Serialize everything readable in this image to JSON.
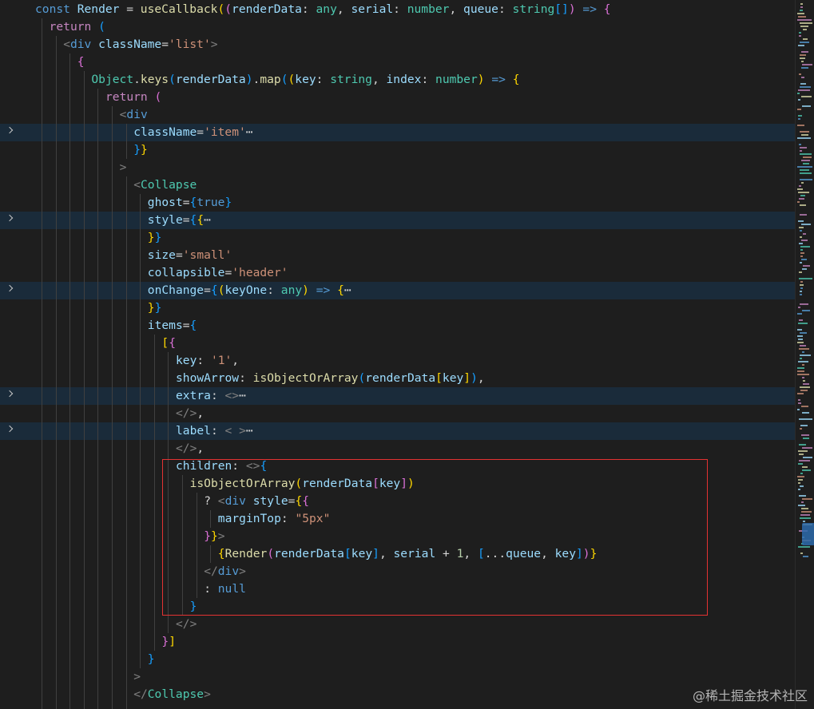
{
  "colors": {
    "keyword": "#569cd6",
    "control": "#c586c0",
    "function": "#dcdcaa",
    "variable": "#9cdcfe",
    "string": "#ce9178",
    "type": "#4ec9b0",
    "number": "#b5cea8",
    "tag": "#569cd6",
    "brace_gold": "#ffd700",
    "brace_pink": "#da70d6",
    "brace_blue": "#179fff",
    "punct": "#d4d4d4",
    "tagpunct": "#808080",
    "highlight_box": "#e33232",
    "editor_bg": "#1e1e1e",
    "folded_line_bg": "#1a2b3a"
  },
  "editor": {
    "lines": [
      {
        "indent": 0,
        "guides": 0,
        "tokens": [
          {
            "t": "const ",
            "c": "keyword"
          },
          {
            "t": "Render",
            "c": "variable"
          },
          {
            "t": " = ",
            "c": "punct"
          },
          {
            "t": "useCallback",
            "c": "function"
          },
          {
            "t": "(",
            "c": "brace_gold"
          },
          {
            "t": "(",
            "c": "brace_pink"
          },
          {
            "t": "renderData",
            "c": "variable"
          },
          {
            "t": ": ",
            "c": "punct"
          },
          {
            "t": "any",
            "c": "type"
          },
          {
            "t": ", ",
            "c": "punct"
          },
          {
            "t": "serial",
            "c": "variable"
          },
          {
            "t": ": ",
            "c": "punct"
          },
          {
            "t": "number",
            "c": "type"
          },
          {
            "t": ", ",
            "c": "punct"
          },
          {
            "t": "queue",
            "c": "variable"
          },
          {
            "t": ": ",
            "c": "punct"
          },
          {
            "t": "string",
            "c": "type"
          },
          {
            "t": "[]",
            "c": "brace_blue"
          },
          {
            "t": ")",
            "c": "brace_pink"
          },
          {
            "t": " => ",
            "c": "keyword"
          },
          {
            "t": "{",
            "c": "brace_pink"
          }
        ]
      },
      {
        "indent": 1,
        "guides": 1,
        "tokens": [
          {
            "t": "return ",
            "c": "control"
          },
          {
            "t": "(",
            "c": "brace_blue"
          }
        ]
      },
      {
        "indent": 2,
        "guides": 2,
        "tokens": [
          {
            "t": "<",
            "c": "tagpunct"
          },
          {
            "t": "div ",
            "c": "tag"
          },
          {
            "t": "className",
            "c": "variable"
          },
          {
            "t": "=",
            "c": "punct"
          },
          {
            "t": "'list'",
            "c": "string"
          },
          {
            "t": ">",
            "c": "tagpunct"
          }
        ]
      },
      {
        "indent": 3,
        "guides": 3,
        "tokens": [
          {
            "t": "{",
            "c": "brace_pink"
          }
        ]
      },
      {
        "indent": 4,
        "guides": 4,
        "tokens": [
          {
            "t": "Object",
            "c": "type"
          },
          {
            "t": ".",
            "c": "punct"
          },
          {
            "t": "keys",
            "c": "function"
          },
          {
            "t": "(",
            "c": "brace_blue"
          },
          {
            "t": "renderData",
            "c": "variable"
          },
          {
            "t": ")",
            "c": "brace_blue"
          },
          {
            "t": ".",
            "c": "punct"
          },
          {
            "t": "map",
            "c": "function"
          },
          {
            "t": "(",
            "c": "brace_blue"
          },
          {
            "t": "(",
            "c": "brace_gold"
          },
          {
            "t": "key",
            "c": "variable"
          },
          {
            "t": ": ",
            "c": "punct"
          },
          {
            "t": "string",
            "c": "type"
          },
          {
            "t": ", ",
            "c": "punct"
          },
          {
            "t": "index",
            "c": "variable"
          },
          {
            "t": ": ",
            "c": "punct"
          },
          {
            "t": "number",
            "c": "type"
          },
          {
            "t": ")",
            "c": "brace_gold"
          },
          {
            "t": " => ",
            "c": "keyword"
          },
          {
            "t": "{",
            "c": "brace_gold"
          }
        ]
      },
      {
        "indent": 5,
        "guides": 5,
        "tokens": [
          {
            "t": "return ",
            "c": "control"
          },
          {
            "t": "(",
            "c": "brace_pink"
          }
        ]
      },
      {
        "indent": 6,
        "guides": 6,
        "tokens": [
          {
            "t": "<",
            "c": "tagpunct"
          },
          {
            "t": "div",
            "c": "tag"
          }
        ]
      },
      {
        "indent": 7,
        "guides": 7,
        "folded": true,
        "tokens": [
          {
            "t": "className",
            "c": "variable"
          },
          {
            "t": "=",
            "c": "punct"
          },
          {
            "t": "'item'",
            "c": "string"
          },
          {
            "t": "⋯",
            "c": "punct"
          }
        ]
      },
      {
        "indent": 7,
        "guides": 7,
        "tokens": [
          {
            "t": "}",
            "c": "brace_blue"
          },
          {
            "t": "}",
            "c": "brace_gold"
          }
        ]
      },
      {
        "indent": 6,
        "guides": 6,
        "tokens": [
          {
            "t": ">",
            "c": "tagpunct"
          }
        ]
      },
      {
        "indent": 7,
        "guides": 7,
        "tokens": [
          {
            "t": "<",
            "c": "tagpunct"
          },
          {
            "t": "Collapse",
            "c": "type"
          }
        ]
      },
      {
        "indent": 8,
        "guides": 8,
        "tokens": [
          {
            "t": "ghost",
            "c": "variable"
          },
          {
            "t": "=",
            "c": "punct"
          },
          {
            "t": "{",
            "c": "brace_blue"
          },
          {
            "t": "true",
            "c": "keyword"
          },
          {
            "t": "}",
            "c": "brace_blue"
          }
        ]
      },
      {
        "indent": 8,
        "guides": 8,
        "folded": true,
        "tokens": [
          {
            "t": "style",
            "c": "variable"
          },
          {
            "t": "=",
            "c": "punct"
          },
          {
            "t": "{",
            "c": "brace_blue"
          },
          {
            "t": "{",
            "c": "brace_gold"
          },
          {
            "t": "⋯",
            "c": "punct"
          }
        ]
      },
      {
        "indent": 8,
        "guides": 8,
        "tokens": [
          {
            "t": "}",
            "c": "brace_gold"
          },
          {
            "t": "}",
            "c": "brace_blue"
          }
        ]
      },
      {
        "indent": 8,
        "guides": 8,
        "tokens": [
          {
            "t": "size",
            "c": "variable"
          },
          {
            "t": "=",
            "c": "punct"
          },
          {
            "t": "'small'",
            "c": "string"
          }
        ]
      },
      {
        "indent": 8,
        "guides": 8,
        "tokens": [
          {
            "t": "collapsible",
            "c": "variable"
          },
          {
            "t": "=",
            "c": "punct"
          },
          {
            "t": "'header'",
            "c": "string"
          }
        ]
      },
      {
        "indent": 8,
        "guides": 8,
        "folded": true,
        "tokens": [
          {
            "t": "onChange",
            "c": "variable"
          },
          {
            "t": "=",
            "c": "punct"
          },
          {
            "t": "{",
            "c": "brace_blue"
          },
          {
            "t": "(",
            "c": "brace_gold"
          },
          {
            "t": "keyOne",
            "c": "variable"
          },
          {
            "t": ": ",
            "c": "punct"
          },
          {
            "t": "any",
            "c": "type"
          },
          {
            "t": ")",
            "c": "brace_gold"
          },
          {
            "t": " => ",
            "c": "keyword"
          },
          {
            "t": "{",
            "c": "brace_gold"
          },
          {
            "t": "⋯",
            "c": "punct"
          }
        ]
      },
      {
        "indent": 8,
        "guides": 8,
        "tokens": [
          {
            "t": "}",
            "c": "brace_gold"
          },
          {
            "t": "}",
            "c": "brace_blue"
          }
        ]
      },
      {
        "indent": 8,
        "guides": 8,
        "tokens": [
          {
            "t": "items",
            "c": "variable"
          },
          {
            "t": "=",
            "c": "punct"
          },
          {
            "t": "{",
            "c": "brace_blue"
          }
        ]
      },
      {
        "indent": 9,
        "guides": 9,
        "tokens": [
          {
            "t": "[",
            "c": "brace_gold"
          },
          {
            "t": "{",
            "c": "brace_pink"
          }
        ]
      },
      {
        "indent": 10,
        "guides": 10,
        "tokens": [
          {
            "t": "key",
            "c": "variable"
          },
          {
            "t": ": ",
            "c": "punct"
          },
          {
            "t": "'1'",
            "c": "string"
          },
          {
            "t": ",",
            "c": "punct"
          }
        ]
      },
      {
        "indent": 10,
        "guides": 10,
        "tokens": [
          {
            "t": "showArrow",
            "c": "variable"
          },
          {
            "t": ": ",
            "c": "punct"
          },
          {
            "t": "isObjectOrArray",
            "c": "function"
          },
          {
            "t": "(",
            "c": "brace_blue"
          },
          {
            "t": "renderData",
            "c": "variable"
          },
          {
            "t": "[",
            "c": "brace_gold"
          },
          {
            "t": "key",
            "c": "variable"
          },
          {
            "t": "]",
            "c": "brace_gold"
          },
          {
            "t": ")",
            "c": "brace_blue"
          },
          {
            "t": ",",
            "c": "punct"
          }
        ]
      },
      {
        "indent": 10,
        "guides": 10,
        "folded": true,
        "tokens": [
          {
            "t": "extra",
            "c": "variable"
          },
          {
            "t": ": ",
            "c": "punct"
          },
          {
            "t": "<>",
            "c": "tagpunct"
          },
          {
            "t": "⋯",
            "c": "punct"
          }
        ]
      },
      {
        "indent": 10,
        "guides": 10,
        "tokens": [
          {
            "t": "</>",
            "c": "tagpunct"
          },
          {
            "t": ",",
            "c": "punct"
          }
        ]
      },
      {
        "indent": 10,
        "guides": 10,
        "folded": true,
        "tokens": [
          {
            "t": "label",
            "c": "variable"
          },
          {
            "t": ": ",
            "c": "punct"
          },
          {
            "t": "< >",
            "c": "tagpunct"
          },
          {
            "t": "⋯",
            "c": "punct"
          }
        ]
      },
      {
        "indent": 10,
        "guides": 10,
        "tokens": [
          {
            "t": "</>",
            "c": "tagpunct"
          },
          {
            "t": ",",
            "c": "punct"
          }
        ]
      },
      {
        "indent": 10,
        "guides": 10,
        "tokens": [
          {
            "t": "children",
            "c": "variable"
          },
          {
            "t": ": ",
            "c": "punct"
          },
          {
            "t": "<>",
            "c": "tagpunct"
          },
          {
            "t": "{",
            "c": "brace_blue"
          }
        ]
      },
      {
        "indent": 11,
        "guides": 11,
        "tokens": [
          {
            "t": "isObjectOrArray",
            "c": "function"
          },
          {
            "t": "(",
            "c": "brace_gold"
          },
          {
            "t": "renderData",
            "c": "variable"
          },
          {
            "t": "[",
            "c": "brace_pink"
          },
          {
            "t": "key",
            "c": "variable"
          },
          {
            "t": "]",
            "c": "brace_pink"
          },
          {
            "t": ")",
            "c": "brace_gold"
          }
        ]
      },
      {
        "indent": 12,
        "guides": 12,
        "tokens": [
          {
            "t": "? ",
            "c": "punct"
          },
          {
            "t": "<",
            "c": "tagpunct"
          },
          {
            "t": "div ",
            "c": "tag"
          },
          {
            "t": "style",
            "c": "variable"
          },
          {
            "t": "=",
            "c": "punct"
          },
          {
            "t": "{",
            "c": "brace_gold"
          },
          {
            "t": "{",
            "c": "brace_pink"
          }
        ]
      },
      {
        "indent": 13,
        "guides": 13,
        "tokens": [
          {
            "t": "marginTop",
            "c": "variable"
          },
          {
            "t": ": ",
            "c": "punct"
          },
          {
            "t": "\"5px\"",
            "c": "string"
          }
        ]
      },
      {
        "indent": 12,
        "guides": 12,
        "tokens": [
          {
            "t": "}",
            "c": "brace_pink"
          },
          {
            "t": "}",
            "c": "brace_gold"
          },
          {
            "t": ">",
            "c": "tagpunct"
          }
        ]
      },
      {
        "indent": 13,
        "guides": 13,
        "tokens": [
          {
            "t": "{",
            "c": "brace_gold"
          },
          {
            "t": "Render",
            "c": "function"
          },
          {
            "t": "(",
            "c": "brace_pink"
          },
          {
            "t": "renderData",
            "c": "variable"
          },
          {
            "t": "[",
            "c": "brace_blue"
          },
          {
            "t": "key",
            "c": "variable"
          },
          {
            "t": "]",
            "c": "brace_blue"
          },
          {
            "t": ", ",
            "c": "punct"
          },
          {
            "t": "serial",
            "c": "variable"
          },
          {
            "t": " + ",
            "c": "punct"
          },
          {
            "t": "1",
            "c": "number"
          },
          {
            "t": ", ",
            "c": "punct"
          },
          {
            "t": "[",
            "c": "brace_blue"
          },
          {
            "t": "...",
            "c": "punct"
          },
          {
            "t": "queue",
            "c": "variable"
          },
          {
            "t": ", ",
            "c": "punct"
          },
          {
            "t": "key",
            "c": "variable"
          },
          {
            "t": "]",
            "c": "brace_blue"
          },
          {
            "t": ")",
            "c": "brace_pink"
          },
          {
            "t": "}",
            "c": "brace_gold"
          }
        ]
      },
      {
        "indent": 12,
        "guides": 12,
        "tokens": [
          {
            "t": "</",
            "c": "tagpunct"
          },
          {
            "t": "div",
            "c": "tag"
          },
          {
            "t": ">",
            "c": "tagpunct"
          }
        ]
      },
      {
        "indent": 12,
        "guides": 12,
        "tokens": [
          {
            "t": ": ",
            "c": "punct"
          },
          {
            "t": "null",
            "c": "keyword"
          }
        ]
      },
      {
        "indent": 11,
        "guides": 11,
        "tokens": [
          {
            "t": "}",
            "c": "brace_blue"
          }
        ]
      },
      {
        "indent": 10,
        "guides": 10,
        "tokens": [
          {
            "t": "</>",
            "c": "tagpunct"
          }
        ]
      },
      {
        "indent": 9,
        "guides": 9,
        "tokens": [
          {
            "t": "}",
            "c": "brace_pink"
          },
          {
            "t": "]",
            "c": "brace_gold"
          }
        ]
      },
      {
        "indent": 8,
        "guides": 8,
        "tokens": [
          {
            "t": "}",
            "c": "brace_blue"
          }
        ]
      },
      {
        "indent": 7,
        "guides": 7,
        "tokens": [
          {
            "t": ">",
            "c": "tagpunct"
          }
        ]
      },
      {
        "indent": 7,
        "guides": 7,
        "tokens": [
          {
            "t": "</",
            "c": "tagpunct"
          },
          {
            "t": "Collapse",
            "c": "type"
          },
          {
            "t": ">",
            "c": "tagpunct"
          }
        ]
      },
      {
        "indent": 7,
        "guides": 7,
        "tokens": []
      }
    ]
  },
  "watermark": "@稀土掘金技术社区"
}
